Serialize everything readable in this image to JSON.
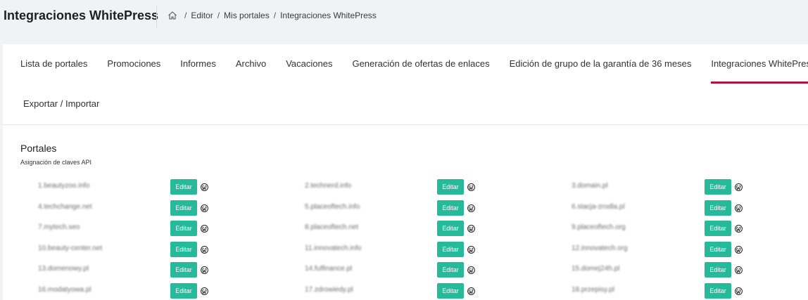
{
  "app_title": "Integraciones WhitePress",
  "breadcrumb": {
    "home_icon": "home-icon",
    "items": [
      "Editor",
      "Mis portales",
      "Integraciones WhitePress"
    ]
  },
  "tabs": [
    {
      "label": "Lista de portales",
      "active": false
    },
    {
      "label": "Promociones",
      "active": false
    },
    {
      "label": "Informes",
      "active": false
    },
    {
      "label": "Archivo",
      "active": false
    },
    {
      "label": "Vacaciones",
      "active": false
    },
    {
      "label": "Generación de ofertas de enlaces",
      "active": false
    },
    {
      "label": "Edición de grupo de la garantía de 36 meses",
      "active": false
    },
    {
      "label": "Integraciones WhitePress",
      "active": true
    },
    {
      "label": "Exportar / Importar",
      "active": false
    }
  ],
  "section": {
    "title": "Portales",
    "subtitle": "Asignación de claves API"
  },
  "edit_label": "Editar",
  "accent_color": "#b3123f",
  "button_color": "#26b99a",
  "portals": [
    "1.beautyzoo.info",
    "2.technerd.info",
    "3.domain.pl",
    "4.techchange.net",
    "5.placeoftech.info",
    "6.stacja-zrodla.pl",
    "7.mytech.seo",
    "8.placeoftech.net",
    "9.placeoftech.org",
    "10.beauty-center.net",
    "11.innovatech.info",
    "12.innovatech.org",
    "13.domenowy.pl",
    "14.fulfinance.pl",
    "15.domej24h.pl",
    "16.modatyowa.pl",
    "17.zdrowiedy.pl",
    "18.przepisy.pl"
  ]
}
